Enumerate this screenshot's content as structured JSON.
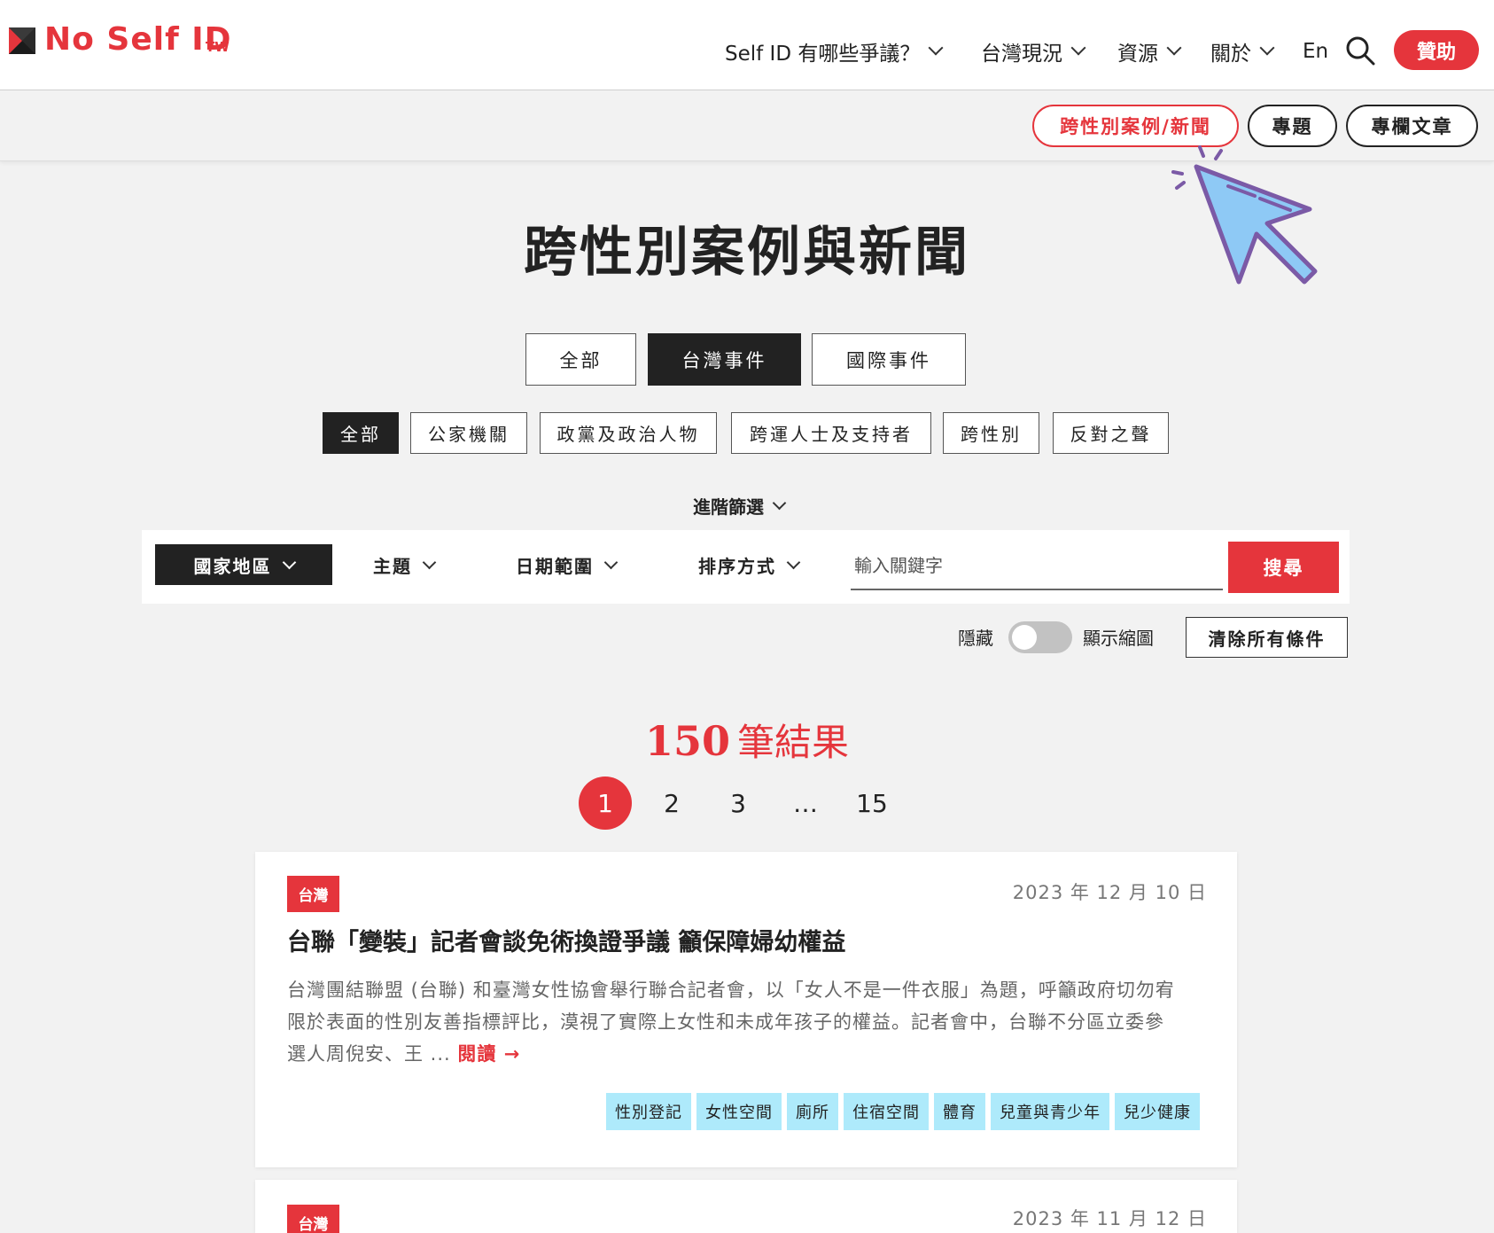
{
  "header": {
    "logo_text": "No Self ID",
    "logo_suffix": "TW",
    "nav": [
      {
        "label": "Self ID 有哪些爭議？"
      },
      {
        "label": "台灣現況"
      },
      {
        "label": "資源"
      },
      {
        "label": "關於"
      }
    ],
    "lang": "En",
    "sponsor": "贊助"
  },
  "subnav": {
    "items": [
      "跨性別案例/新聞",
      "專題",
      "專欄文章"
    ],
    "active_index": 0
  },
  "page_title": "跨性別案例與新聞",
  "tabs": {
    "items": [
      "全部",
      "台灣事件",
      "國際事件"
    ],
    "active_index": 1
  },
  "categories": {
    "items": [
      "全部",
      "公家機關",
      "政黨及政治人物",
      "跨運人士及支持者",
      "跨性別",
      "反對之聲"
    ],
    "active_index": 0
  },
  "advanced": {
    "label": "進階篩選"
  },
  "filters": {
    "country": "國家地區",
    "topic": "主題",
    "date_range": "日期範圍",
    "sort": "排序方式",
    "keyword_placeholder": "輸入關鍵字",
    "search": "搜尋"
  },
  "thumbnail_toggle": {
    "off_label": "隱藏",
    "on_label": "顯示縮圖",
    "checked": false
  },
  "clear_all": "清除所有條件",
  "results": {
    "count": "150",
    "label": "筆結果"
  },
  "pagination": {
    "pages": [
      "1",
      "2",
      "3",
      "…",
      "15"
    ],
    "active_index": 0
  },
  "articles": [
    {
      "badge": "台灣",
      "date": "2023 年 12 月 10 日",
      "title": "台聯「變裝」記者會談免術換證爭議 籲保障婦幼權益",
      "summary": "台灣團結聯盟 (台聯) 和臺灣女性協會舉行聯合記者會，以「女人不是一件衣服」為題，呼籲政府切勿宥限於表面的性別友善指標評比，漠視了實際上女性和未成年孩子的權益。記者會中，台聯不分區立委參選人周倪安、王 ...",
      "read_more": "閱讀 →",
      "tags": [
        "性別登記",
        "女性空間",
        "廁所",
        "住宿空間",
        "體育",
        "兒童與青少年",
        "兒少健康"
      ]
    },
    {
      "badge": "台灣",
      "date": "2023 年 11 月 12 日"
    }
  ],
  "colors": {
    "accent": "#e5353c",
    "dark": "#222222",
    "tag_bg": "#aeeafb",
    "page_bg": "#f2f2f2",
    "cursor_fill": "#8ec9f5",
    "cursor_stroke": "#7b5aa6"
  },
  "icons": {
    "logo": "no-self-id-logo-icon",
    "search": "search-icon",
    "chevron": "chevron-down-icon",
    "cursor": "pointer-cursor-icon"
  }
}
